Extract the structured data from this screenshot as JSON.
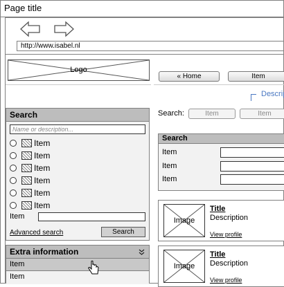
{
  "window": {
    "title": "Page title"
  },
  "browser": {
    "back_icon": "arrow-left-icon",
    "forward_icon": "arrow-right-icon",
    "url": "http://www.isabel.nl"
  },
  "header": {
    "logo_text": "Logo",
    "nav": [
      {
        "label": "« Home"
      },
      {
        "label": "Item"
      }
    ],
    "description_link": "Descrip"
  },
  "left_search": {
    "title": "Search",
    "placeholder": "Name or description...",
    "radio_items": [
      {
        "label": "Item"
      },
      {
        "label": "Item"
      },
      {
        "label": "Item"
      },
      {
        "label": "Item"
      },
      {
        "label": "Item"
      },
      {
        "label": "Item"
      }
    ],
    "item_field_label": "Item",
    "advanced_link": "Advanced search",
    "search_button": "Search"
  },
  "extra_info": {
    "title": "Extra information",
    "collapse_icon": "double-chevron-down-icon",
    "items": [
      {
        "label": "Item",
        "selected": true
      },
      {
        "label": "Item",
        "selected": false
      }
    ],
    "cursor_icon": "hand-pointer-icon"
  },
  "search_bar": {
    "label": "Search:",
    "tabs": [
      {
        "label": "Item"
      },
      {
        "label": "Item"
      }
    ]
  },
  "right_search": {
    "title": "Search",
    "fields": [
      {
        "label": "Item"
      },
      {
        "label": "Item"
      },
      {
        "label": "Item"
      }
    ]
  },
  "results": [
    {
      "image_label": "Image",
      "title": "Title",
      "description": "Description",
      "link": "View profile"
    },
    {
      "image_label": "Image",
      "title": "Title",
      "description": "Description",
      "link": "View profile"
    }
  ]
}
